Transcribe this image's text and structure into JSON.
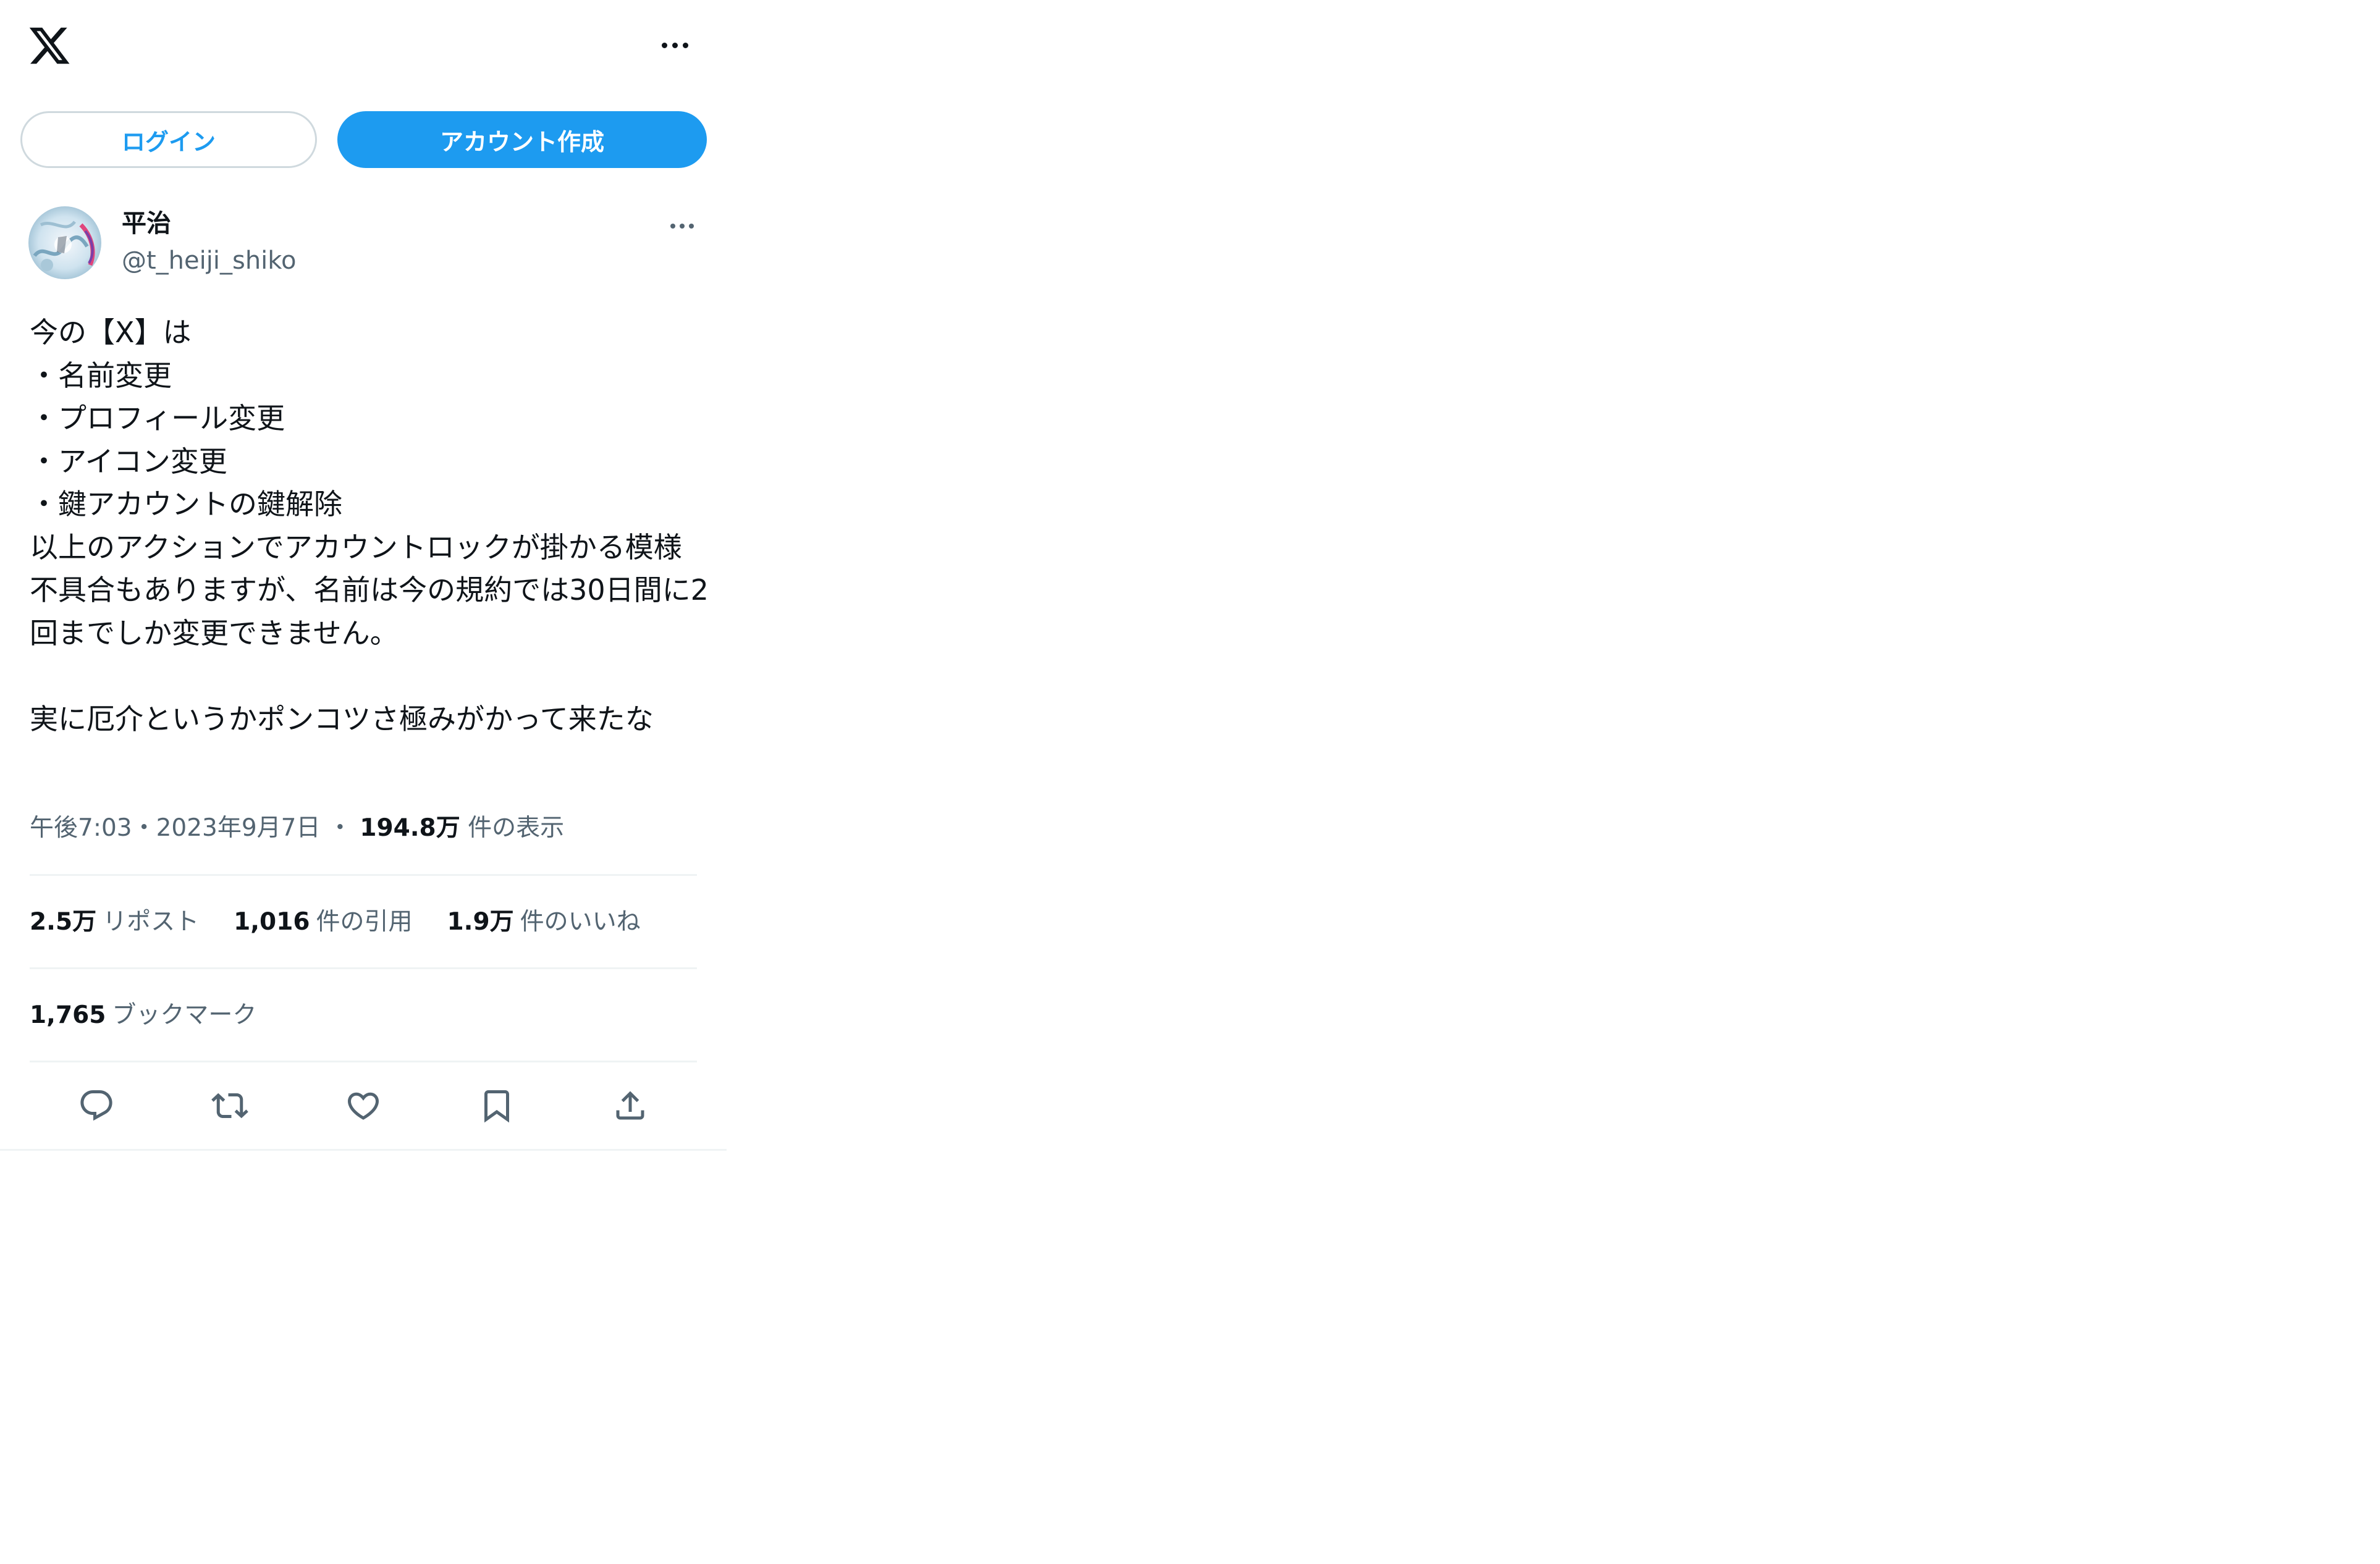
{
  "header": {
    "logo_icon": "x-logo-icon",
    "more_icon": "more-horizontal-icon"
  },
  "auth": {
    "login_label": "ログイン",
    "signup_label": "アカウント作成"
  },
  "tweet": {
    "display_name": "平治",
    "handle": "@t_heiji_shiko",
    "text": "今の【X】は\n・名前変更\n・プロフィール変更\n・アイコン変更\n・鍵アカウントの鍵解除\n以上のアクションでアカウントロックが掛かる模様\n不具合もありますが、名前は今の規約では30日間に2回までしか変更できません。\n\n実に厄介というかポンコツさ極みがかって来たな",
    "time": "午後7:03",
    "date": "2023年9月7日",
    "sep": "・",
    "views_count": "194.8万",
    "views_label": "件の表示"
  },
  "stats": {
    "reposts_count": "2.5万",
    "reposts_label": "リポスト",
    "quotes_count": "1,016",
    "quotes_label": "件の引用",
    "likes_count": "1.9万",
    "likes_label": "件のいいね",
    "bookmarks_count": "1,765",
    "bookmarks_label": "ブックマーク"
  },
  "actions": [
    "reply-icon",
    "repost-icon",
    "like-icon",
    "bookmark-icon",
    "share-icon"
  ],
  "colors": {
    "accent": "#1d9bf0",
    "text": "#0f1419",
    "secondary": "#536471",
    "border": "#cfd9de",
    "divider": "#eff3f4"
  }
}
